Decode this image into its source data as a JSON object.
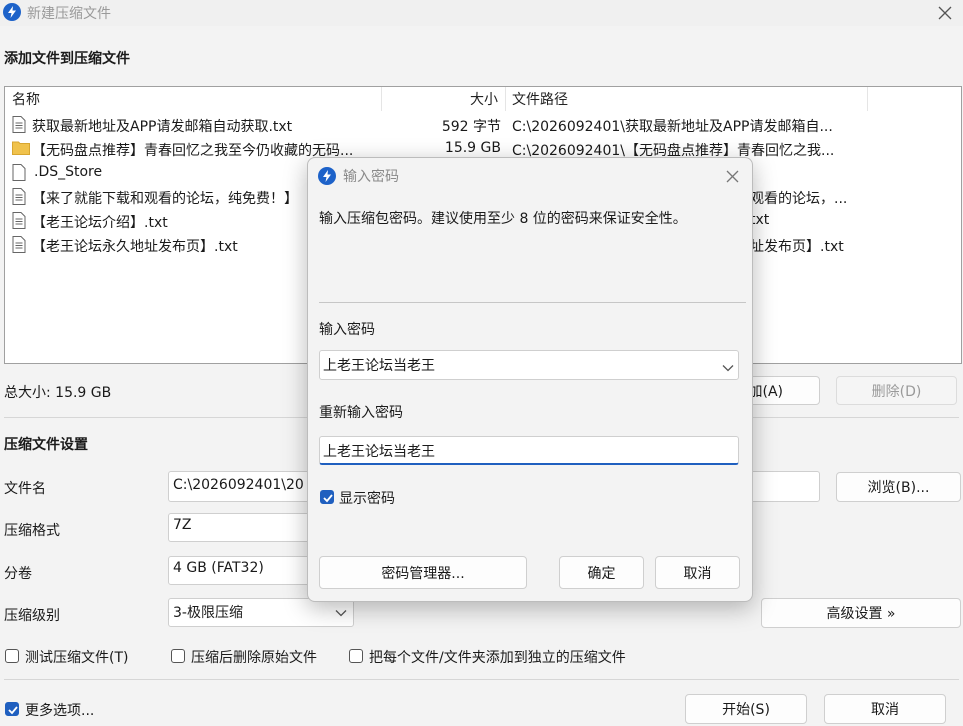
{
  "window": {
    "title": "新建压缩文件",
    "icon": "app-bolt-icon",
    "close_icon": "close-icon"
  },
  "files_section": {
    "title": "添加文件到压缩文件"
  },
  "file_list": {
    "columns": {
      "name": "名称",
      "size": "大小",
      "path": "文件路径"
    },
    "rows": [
      {
        "icon": "text-file-icon",
        "name": "获取最新地址及APP请发邮箱自动获取.txt",
        "size": "592 字节",
        "path": "C:\\2026092401\\获取最新地址及APP请发邮箱自..."
      },
      {
        "icon": "folder-icon",
        "name": "【无码盘点推荐】青春回忆之我至今仍收藏的无码...",
        "size": "15.9 GB",
        "path": "C:\\2026092401\\【无码盘点推荐】青春回忆之我..."
      },
      {
        "icon": "blank-file-icon",
        "name": ".DS_Store",
        "size": "",
        "path": ""
      },
      {
        "icon": "text-file-icon",
        "name": "【来了就能下载和观看的论坛，纯免费！】",
        "size": "",
        "path": "观看的论坛，..."
      },
      {
        "icon": "text-file-icon",
        "name": "【老王论坛介绍】.txt",
        "size": "",
        "path": "txt"
      },
      {
        "icon": "text-file-icon",
        "name": "【老王论坛永久地址发布页】.txt",
        "size": "",
        "path": "址发布页】.txt"
      }
    ]
  },
  "total_size": "总大小: 15.9 GB",
  "buttons": {
    "add": "加(A)",
    "delete": "删除(D)",
    "browse": "浏览(B)...",
    "advanced": "高级设置 »",
    "start": "开始(S)",
    "cancel": "取消"
  },
  "settings": {
    "title": "压缩文件设置",
    "filename_label": "文件名",
    "filename_value": "C:\\2026092401\\20",
    "format_label": "压缩格式",
    "format_value": "7Z",
    "volume_label": "分卷",
    "volume_value": "4 GB (FAT32)",
    "level_label": "压缩级别",
    "level_value": "3-极限压缩"
  },
  "options": {
    "test": "测试压缩文件(T)",
    "delete_after": "压缩后删除原始文件",
    "separate": "把每个文件/文件夹添加到独立的压缩文件",
    "more": "更多选项..."
  },
  "dialog": {
    "title": "输入密码",
    "description": "输入压缩包密码。建议使用至少 8 位的密码来保证安全性。",
    "password_label": "输入密码",
    "password_value": "上老王论坛当老王",
    "confirm_label": "重新输入密码",
    "confirm_value": "上老王论坛当老王",
    "show_password": "显示密码",
    "manager_button": "密码管理器...",
    "ok_button": "确定",
    "cancel_button": "取消"
  },
  "colors": {
    "accent": "#1f5fbf",
    "folder": "#f0c24c"
  }
}
